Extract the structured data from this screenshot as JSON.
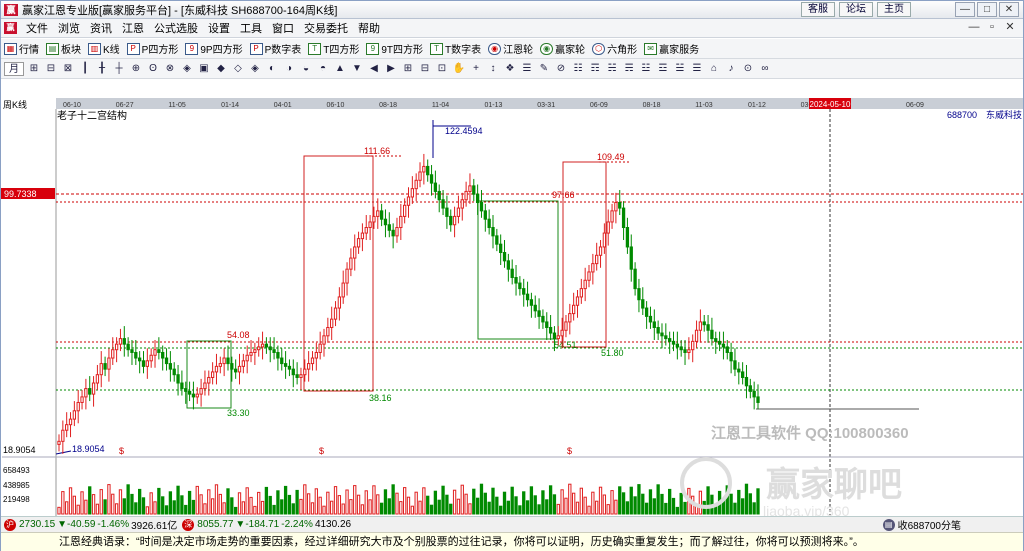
{
  "window": {
    "title": "赢家江恩专业版[赢家服务平台] - [东威科技  SH688700-164周K线]",
    "links": [
      "客服",
      "论坛",
      "主页"
    ],
    "controls": [
      "minimize-icon",
      "maximize-icon",
      "close-icon"
    ]
  },
  "menu": {
    "items": [
      "文件",
      "浏览",
      "资讯",
      "江恩",
      "公式选股",
      "设置",
      "工具",
      "窗口",
      "交易委托",
      "帮助"
    ],
    "right_controls": [
      "—",
      "▫",
      "✕"
    ]
  },
  "toolbar1": {
    "items": [
      {
        "label": "行情",
        "icon": "grid-icon"
      },
      {
        "label": "板块",
        "icon": "blocks-icon"
      },
      {
        "label": "K线",
        "icon": "candles-icon"
      },
      {
        "label": "P四方形",
        "icon": "p-square-icon"
      },
      {
        "label": "9P四方形",
        "icon": "9p-square-icon"
      },
      {
        "label": "P数字表",
        "icon": "p-table-icon"
      },
      {
        "label": "T四方形",
        "icon": "t-square-icon"
      },
      {
        "label": "9T四方形",
        "icon": "9t-square-icon"
      },
      {
        "label": "T数字表",
        "icon": "t-table-icon"
      },
      {
        "label": "江恩轮",
        "icon": "gann-wheel-icon"
      },
      {
        "label": "赢家轮",
        "icon": "winner-wheel-icon"
      },
      {
        "label": "六角形",
        "icon": "hexagon-icon"
      },
      {
        "label": "赢家服务",
        "icon": "service-icon"
      }
    ]
  },
  "toolbar2": {
    "period": "月",
    "icons": [
      "⊞",
      "⊟",
      "⊠",
      "┃",
      "╂",
      "┼",
      "⊕",
      "ʘ",
      "⊗",
      "◈",
      "▣",
      "◆",
      "◇",
      "◈",
      "◐",
      "◑",
      "◒",
      "◓",
      "▲",
      "▼",
      "◀",
      "▶",
      "⊞",
      "⊟",
      "⊡",
      "✋",
      "+",
      "↕",
      "❖",
      "☰",
      "✎",
      "⊘",
      "☷",
      "☶",
      "☵",
      "☴",
      "☳",
      "☲",
      "☱",
      "☰",
      "⌂",
      "♪",
      "⊙",
      "∞"
    ]
  },
  "chart_data": {
    "type": "candlestick",
    "title": "老子十二宫结构",
    "period_label": "周K线",
    "stock": {
      "code": "688700",
      "name": "东威科技"
    },
    "date_ticks": [
      "06-10",
      "06-27",
      "11-05",
      "01-14",
      "04-01",
      "06-10",
      "08-18",
      "11-04",
      "01-13",
      "03-31",
      "06-09",
      "08-18",
      "11-03",
      "01-12",
      "03-22",
      "2024-05-10",
      "06-09"
    ],
    "current_date": "2024-05-10",
    "price_range": [
      14,
      135
    ],
    "cursor_price": "99.7338",
    "volume_ticks": [
      "658493",
      "438985",
      "219498"
    ],
    "annotations": {
      "peaks": [
        "122.4594",
        "111.66",
        "109.49",
        "97.66"
      ],
      "troughs": [
        "54.08",
        "54.51",
        "51.80",
        "38.16",
        "33.30"
      ],
      "low": "18.9054",
      "base_label": "18.9054"
    },
    "boxes": [
      {
        "from": "2021-10",
        "to": "2021-12",
        "low": 33.3,
        "high": 54.08,
        "color": "green"
      },
      {
        "from": "2022-04",
        "to": "2022-08",
        "low": 38.16,
        "high": 111.66,
        "color": "red"
      },
      {
        "from": "2022-11",
        "to": "2023-04",
        "low": 54.51,
        "high": 97.66,
        "color": "green"
      },
      {
        "from": "2023-04",
        "to": "2023-06",
        "low": 51.8,
        "high": 109.49,
        "color": "red"
      }
    ],
    "closes": [
      20,
      24,
      26,
      28,
      31,
      34,
      36,
      39,
      37,
      41,
      44,
      48,
      46,
      50,
      53,
      55,
      57,
      55,
      53,
      52,
      50,
      49,
      47,
      49,
      51,
      53,
      52,
      50,
      48,
      46,
      44,
      41,
      39,
      38,
      37,
      36,
      37,
      39,
      41,
      43,
      45,
      47,
      48,
      50,
      48,
      46,
      45,
      47,
      49,
      51,
      52,
      53,
      54,
      55,
      54,
      53,
      52,
      50,
      48,
      47,
      46,
      44,
      43,
      44,
      46,
      48,
      50,
      52,
      55,
      58,
      61,
      64,
      68,
      72,
      77,
      82,
      86,
      90,
      93,
      95,
      97,
      99,
      101,
      103,
      100,
      98,
      96,
      94,
      97,
      101,
      105,
      108,
      111,
      114,
      117,
      119,
      116,
      113,
      110,
      107,
      104,
      101,
      98,
      101,
      104,
      107,
      110,
      112,
      109,
      106,
      103,
      100,
      97,
      94,
      91,
      88,
      85,
      82,
      79,
      77,
      75,
      73,
      71,
      69,
      67,
      65,
      63,
      61,
      59,
      57,
      58,
      60,
      63,
      66,
      69,
      72,
      75,
      78,
      81,
      84,
      87,
      90,
      95,
      99,
      103,
      106,
      104,
      97,
      90,
      82,
      75,
      71,
      68,
      65,
      63,
      61,
      59,
      58,
      57,
      56,
      55,
      54,
      53,
      52,
      53,
      56,
      60,
      63,
      62,
      60,
      57,
      56,
      55,
      54,
      52,
      49,
      46,
      45,
      43,
      40,
      38,
      36,
      34
    ]
  },
  "status": {
    "sh_index": "2730.15",
    "sh_change": "▼-40.59",
    "sh_pct": "-1.46%",
    "sh_amount": "3926.61亿",
    "sz_index": "8055.77",
    "sz_change": "▼-184.71",
    "sz_pct": "-2.24%",
    "sz_amount": "4130.26",
    "right": "收688700分笔"
  },
  "quote": "江恩经典语录：“时间是决定市场走势的重要因素，经过详细研究大市及个别股票的过往记录，你将可以证明，历史确实重复发生；而了解过往，你将可以预测将来。”。",
  "watermark": {
    "line1": "江恩工具软件  QQ:100800360",
    "line2": "赢家聊吧",
    "line3": "liaoba.vip/360"
  }
}
